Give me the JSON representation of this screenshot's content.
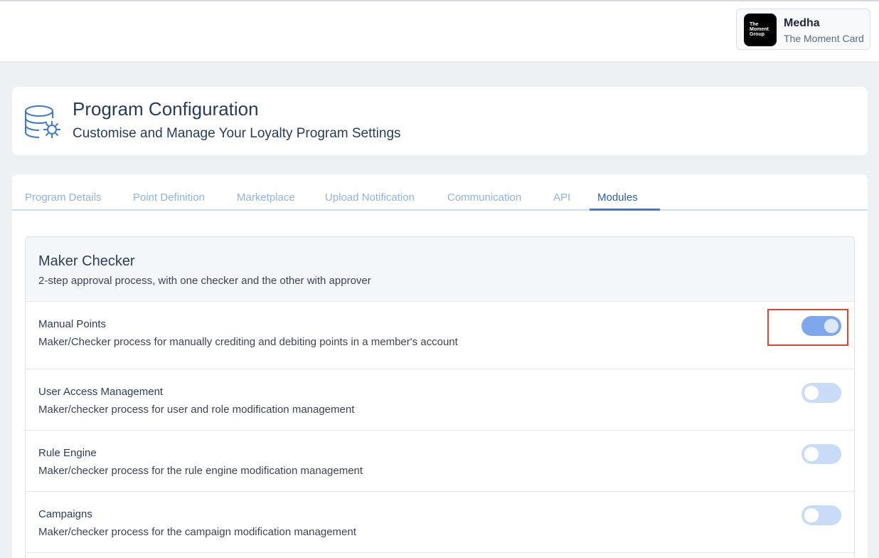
{
  "user": {
    "logo_text": "The\nMoment\nGroup",
    "name": "Medha",
    "org": "The Moment Card"
  },
  "header": {
    "icon": "database-settings-icon",
    "title": "Program Configuration",
    "subtitle": "Customise and Manage Your Loyalty Program Settings"
  },
  "tabs": [
    {
      "label": "Program Details"
    },
    {
      "label": "Point Definition"
    },
    {
      "label": "Marketplace"
    },
    {
      "label": "Upload Notification"
    },
    {
      "label": "Communication"
    },
    {
      "label": "API"
    },
    {
      "label": "Modules",
      "active": true
    }
  ],
  "section": {
    "title": "Maker Checker",
    "description": "2-step approval process, with one checker and the other with approver"
  },
  "modules": [
    {
      "title": "Manual Points",
      "description": "Maker/Checker process for manually crediting and debiting points in a member's account",
      "enabled": true
    },
    {
      "title": "User Access Management",
      "description": "Maker/checker process for user and role modification management",
      "enabled": false
    },
    {
      "title": "Rule Engine",
      "description": "Maker/checker process for the rule engine modification management",
      "enabled": false
    },
    {
      "title": "Campaigns",
      "description": "Maker/checker process for the campaign modification management",
      "enabled": false
    }
  ],
  "colors": {
    "accent": "#3a79d6",
    "toggle_on": "#7fa7ec",
    "toggle_off": "#c9dcf7",
    "highlight": "#e0462f"
  }
}
